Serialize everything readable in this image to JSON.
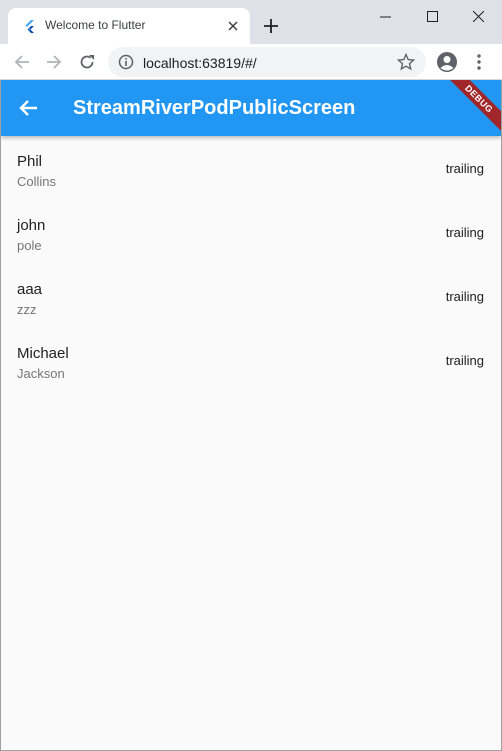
{
  "browser": {
    "tab_title": "Welcome to Flutter",
    "url": "localhost:63819/#/"
  },
  "appbar": {
    "title": "StreamRiverPodPublicScreen",
    "debug_label": "DEBUG"
  },
  "list": [
    {
      "title": "Phil",
      "subtitle": "Collins",
      "trailing": "trailing"
    },
    {
      "title": "john",
      "subtitle": "pole",
      "trailing": "trailing"
    },
    {
      "title": "aaa",
      "subtitle": "zzz",
      "trailing": "trailing"
    },
    {
      "title": "Michael",
      "subtitle": "Jackson",
      "trailing": "trailing"
    }
  ],
  "colors": {
    "appbar": "#2196f3",
    "debug_banner": "#a0262a",
    "background": "#fafafa"
  }
}
